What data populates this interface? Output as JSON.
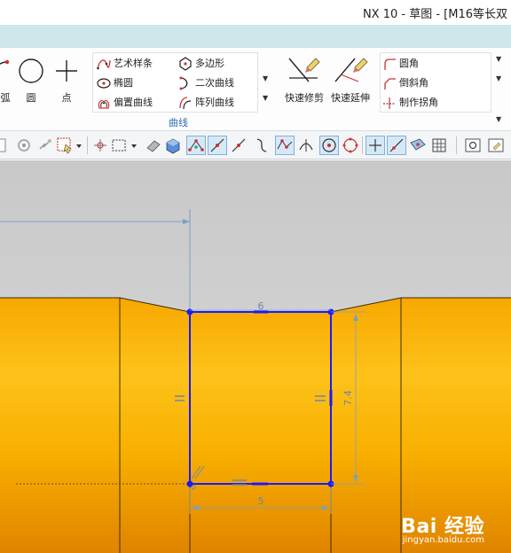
{
  "window": {
    "title": "NX 10 - 草图 - [M16等长双"
  },
  "ribbon": {
    "left_buttons": [
      {
        "label": "弧",
        "icon": "arc-icon"
      },
      {
        "label": "圆",
        "icon": "circle-icon"
      },
      {
        "label": "点",
        "icon": "point-icon"
      }
    ],
    "curve_group": {
      "label": "曲线",
      "col1": [
        {
          "label": "艺术样条",
          "icon": "studio-spline-icon"
        },
        {
          "label": "椭圆",
          "icon": "ellipse-icon"
        },
        {
          "label": "偏置曲线",
          "icon": "offset-curve-icon"
        }
      ],
      "col2": [
        {
          "label": "多边形",
          "icon": "polygon-icon"
        },
        {
          "label": "二次曲线",
          "icon": "conic-icon"
        },
        {
          "label": "阵列曲线",
          "icon": "pattern-curve-icon"
        }
      ]
    },
    "edit_buttons": [
      {
        "label": "快速修剪",
        "icon": "quick-trim-icon"
      },
      {
        "label": "快速延伸",
        "icon": "quick-extend-icon"
      }
    ],
    "corner_group": [
      {
        "label": "圆角",
        "icon": "fillet-icon"
      },
      {
        "label": "倒斜角",
        "icon": "chamfer-icon"
      },
      {
        "label": "制作拐角",
        "icon": "make-corner-icon"
      }
    ]
  },
  "sketch": {
    "dim_top": "6",
    "dim_right": "7.4",
    "dim_bottom": "5"
  },
  "watermark": {
    "logo": "Bai 经验",
    "url": "jingyan.baidu.com"
  },
  "colors": {
    "accent": "#2f6fb3",
    "sketch_blue": "#0000ff",
    "part_orange": "#f7b500",
    "canvas_gray": "#cfcfcf"
  }
}
